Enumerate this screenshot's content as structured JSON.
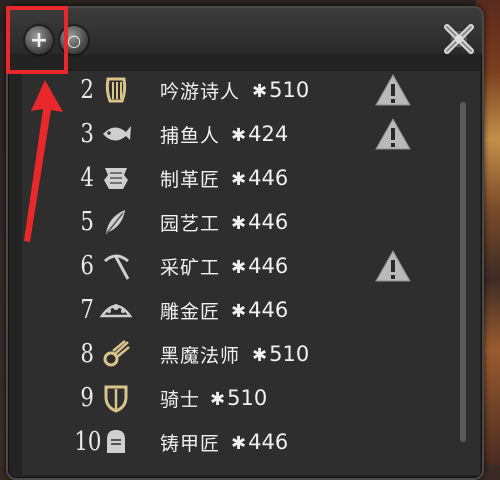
{
  "window": {
    "add_symbol": "+",
    "circle_symbol": "○"
  },
  "jobs": [
    {
      "level": "2",
      "name": "吟游诗人",
      "ilvl": "510",
      "warning": true,
      "icon": "bard-icon"
    },
    {
      "level": "3",
      "name": "捕鱼人",
      "ilvl": "424",
      "warning": true,
      "icon": "fisher-icon"
    },
    {
      "level": "4",
      "name": "制革匠",
      "ilvl": "446",
      "warning": false,
      "icon": "leatherworker-icon"
    },
    {
      "level": "5",
      "name": "园艺工",
      "ilvl": "446",
      "warning": false,
      "icon": "botanist-icon"
    },
    {
      "level": "6",
      "name": "采矿工",
      "ilvl": "446",
      "warning": true,
      "icon": "miner-icon"
    },
    {
      "level": "7",
      "name": "雕金匠",
      "ilvl": "446",
      "warning": false,
      "icon": "goldsmith-icon"
    },
    {
      "level": "8",
      "name": "黑魔法师",
      "ilvl": "510",
      "warning": false,
      "icon": "black-mage-icon"
    },
    {
      "level": "9",
      "name": "骑士",
      "ilvl": "510",
      "warning": false,
      "icon": "paladin-icon"
    },
    {
      "level": "10",
      "name": "铸甲匠",
      "ilvl": "446",
      "warning": false,
      "icon": "armorer-icon"
    }
  ],
  "colors": {
    "highlight": "#e8282b",
    "warning": "#b9b9b9",
    "text": "#f0f0f0"
  }
}
